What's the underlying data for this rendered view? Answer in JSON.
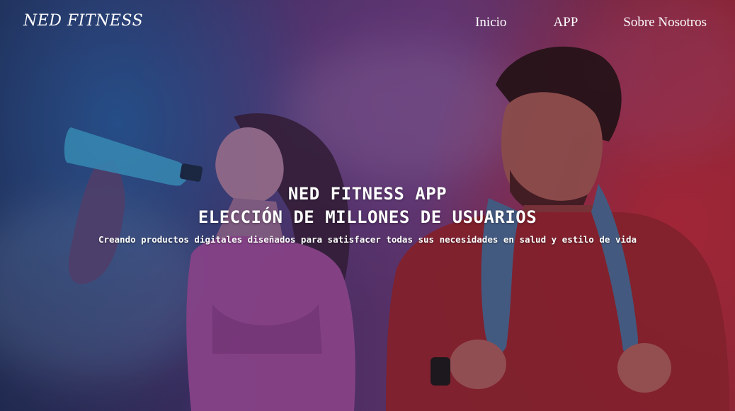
{
  "nav": {
    "brand": "NED FITNESS",
    "items": [
      {
        "label": "Inicio"
      },
      {
        "label": "APP"
      },
      {
        "label": "Sobre Nosotros"
      }
    ]
  },
  "hero": {
    "title_line1": "NED FITNESS APP",
    "title_line2": "ELECCIÓN DE MILLONES DE USUARIOS",
    "subtitle": "Creando productos digitales diseñados para satisfacer todas sus necesidades en salud y estilo de vida"
  },
  "colors": {
    "text": "#ffffff",
    "background_left": "#23315c",
    "background_mid": "#6d3a78",
    "background_right": "#9a2a3a"
  }
}
